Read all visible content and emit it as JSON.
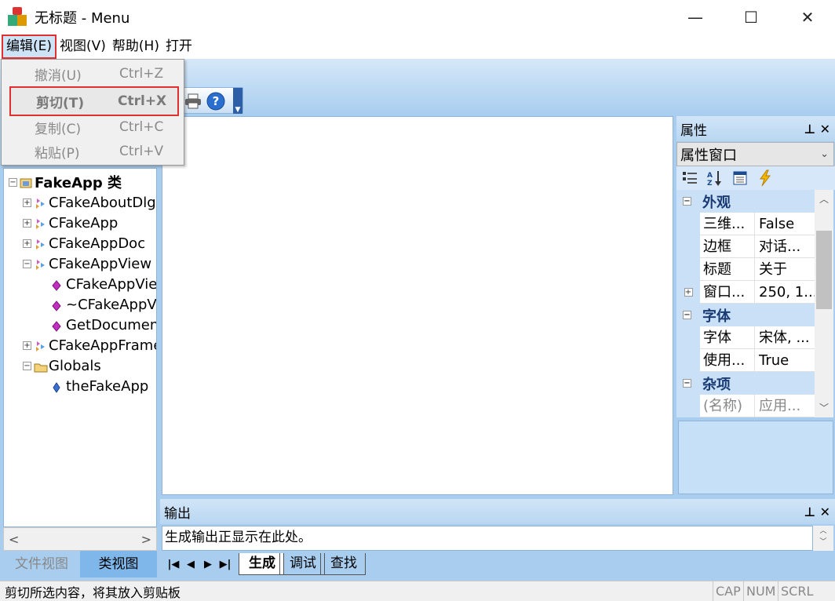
{
  "window": {
    "title": "无标题 - Menu",
    "minimize_glyph": "—",
    "maximize_glyph": "☐",
    "close_glyph": "✕"
  },
  "menubar": {
    "items": [
      {
        "label": "编辑(E)"
      },
      {
        "label": "视图(V)"
      },
      {
        "label": "帮助(H)"
      },
      {
        "label": "打开"
      }
    ]
  },
  "edit_menu": {
    "items": [
      {
        "label": "撤消(U)",
        "shortcut": "Ctrl+Z",
        "enabled": false
      },
      {
        "label": "剪切(T)",
        "shortcut": "Ctrl+X",
        "enabled": false,
        "highlighted": true
      },
      {
        "label": "复制(C)",
        "shortcut": "Ctrl+C",
        "enabled": false
      },
      {
        "label": "粘贴(P)",
        "shortcut": "Ctrl+V",
        "enabled": false
      }
    ]
  },
  "class_view": {
    "tree": [
      {
        "label": "FakeApp 类",
        "level": 0,
        "expander": "−",
        "icon": "class-folder-icon",
        "bold": true
      },
      {
        "label": "CFakeAboutDlg",
        "level": 1,
        "expander": "+",
        "icon": "class-icon"
      },
      {
        "label": "CFakeApp",
        "level": 1,
        "expander": "+",
        "icon": "class-icon"
      },
      {
        "label": "CFakeAppDoc",
        "level": 1,
        "expander": "+",
        "icon": "class-icon"
      },
      {
        "label": "CFakeAppView",
        "level": 1,
        "expander": "−",
        "icon": "class-icon"
      },
      {
        "label": "CFakeAppView",
        "level": 2,
        "expander": "",
        "icon": "method-icon"
      },
      {
        "label": "~CFakeAppView",
        "level": 2,
        "expander": "",
        "icon": "method-icon"
      },
      {
        "label": "GetDocument",
        "level": 2,
        "expander": "",
        "icon": "method-icon"
      },
      {
        "label": "CFakeAppFrame",
        "level": 1,
        "expander": "+",
        "icon": "class-icon"
      },
      {
        "label": "Globals",
        "level": 1,
        "expander": "−",
        "icon": "folder-icon"
      },
      {
        "label": "theFakeApp",
        "level": 2,
        "expander": "",
        "icon": "variable-icon"
      }
    ],
    "tabs": [
      {
        "label": "文件视图",
        "active": false
      },
      {
        "label": "类视图",
        "active": true
      }
    ],
    "scroll_left": "<",
    "scroll_right": ">"
  },
  "properties": {
    "title": "属性",
    "pin_glyph": "⊥",
    "close_glyph": "✕",
    "combo_value": "属性窗口",
    "categories": [
      {
        "label": "外观",
        "expander": "−",
        "rows": [
          {
            "name": "三维...",
            "value": "False",
            "expander": ""
          },
          {
            "name": "边框",
            "value": "对话...",
            "expander": ""
          },
          {
            "name": "标题",
            "value": "关于",
            "expander": ""
          },
          {
            "name": "窗口...",
            "value": "250, 1...",
            "expander": "+"
          }
        ]
      },
      {
        "label": "字体",
        "expander": "−",
        "rows": [
          {
            "name": "字体",
            "value": "宋体, ...",
            "expander": ""
          },
          {
            "name": "使用...",
            "value": "True",
            "expander": ""
          }
        ]
      },
      {
        "label": "杂项",
        "expander": "−",
        "rows": [
          {
            "name": "(名称)",
            "value": "应用...",
            "expander": "",
            "gray": true
          }
        ]
      }
    ]
  },
  "output": {
    "title": "输出",
    "pin_glyph": "⊥",
    "close_glyph": "✕",
    "lines": [
      "生成输出正显示在此处。"
    ],
    "nav": [
      "|◀",
      "◀",
      "▶",
      "▶|"
    ],
    "tabs": [
      {
        "label": "生成",
        "active": true
      },
      {
        "label": "调试",
        "active": false
      },
      {
        "label": "查找",
        "active": false
      }
    ]
  },
  "statusbar": {
    "text": "剪切所选内容，将其放入剪贴板",
    "indicators": [
      "CAP",
      "NUM",
      "SCRL"
    ]
  }
}
